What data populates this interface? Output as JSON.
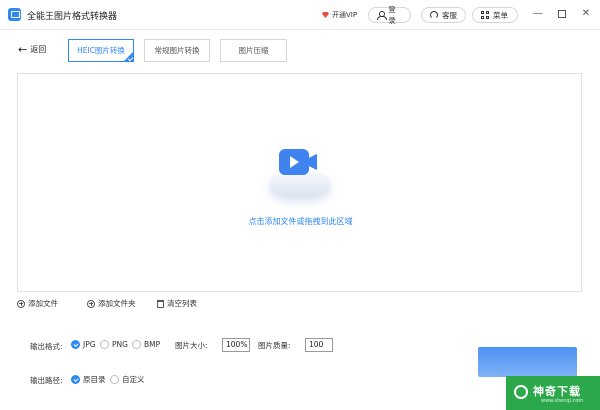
{
  "window": {
    "title": "全能王图片格式转换器",
    "vip_label": "开通VIP",
    "login_label": "登录",
    "service_label": "客服",
    "menu_label": "菜单",
    "minimize_glyph": "—",
    "close_glyph": "✕"
  },
  "toolbar": {
    "back_label": "返回",
    "back_glyph": "←",
    "tabs": [
      {
        "label": "HEIC图片转换",
        "active": true
      },
      {
        "label": "常规图片转换",
        "active": false
      },
      {
        "label": "图片压缩",
        "active": false
      }
    ]
  },
  "dropzone": {
    "hint": "点击添加文件或拖拽到此区域",
    "icon": "video-camera-icon"
  },
  "actions": {
    "add_file": "添加文件",
    "add_folder": "添加文件夹",
    "clear_list": "清空列表"
  },
  "settings": {
    "format_label": "输出格式:",
    "formats": [
      {
        "label": "JPG",
        "selected": true
      },
      {
        "label": "PNG",
        "selected": false
      },
      {
        "label": "BMP",
        "selected": false
      }
    ],
    "size_label": "图片大小:",
    "size_value": "100%",
    "quality_label": "图片质量:",
    "quality_value": "100",
    "path_label": "输出路径:",
    "paths": [
      {
        "label": "原目录",
        "selected": true
      },
      {
        "label": "自定义",
        "selected": false
      }
    ]
  },
  "watermark": {
    "text": "神奇下载",
    "sub": "www.shenqi.com"
  },
  "colors": {
    "accent": "#2f88f3",
    "watermark_green": "#2aa84a"
  }
}
